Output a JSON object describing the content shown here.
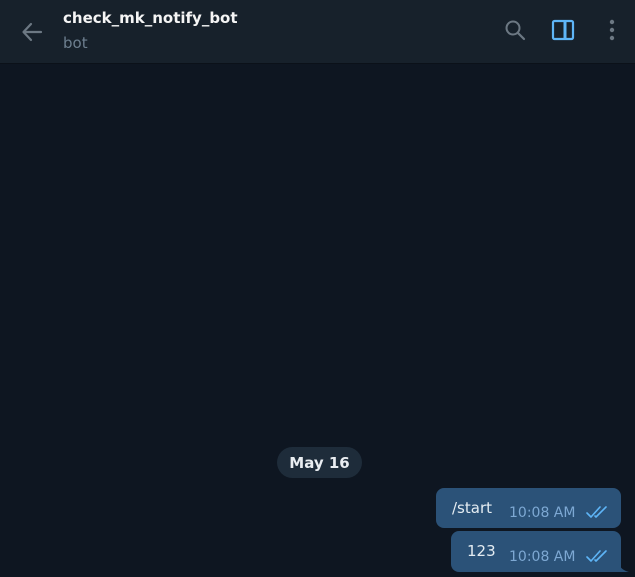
{
  "header": {
    "title": "check_mk_notify_bot",
    "subtitle": "bot",
    "icons": [
      "back-arrow-icon",
      "search-icon",
      "side-panel-icon",
      "more-vertical-icon"
    ]
  },
  "chat": {
    "date_separator": "May 16",
    "messages": [
      {
        "text": "/start",
        "time": "10:08 AM",
        "status": "read"
      },
      {
        "text": "123",
        "time": "10:08 AM",
        "status": "read"
      }
    ]
  },
  "colors": {
    "background": "#0e1621",
    "header": "#17212b",
    "outgoing_bubble": "#2b5278",
    "accent": "#5eb5f7",
    "subtitle": "#6d7f8f"
  }
}
